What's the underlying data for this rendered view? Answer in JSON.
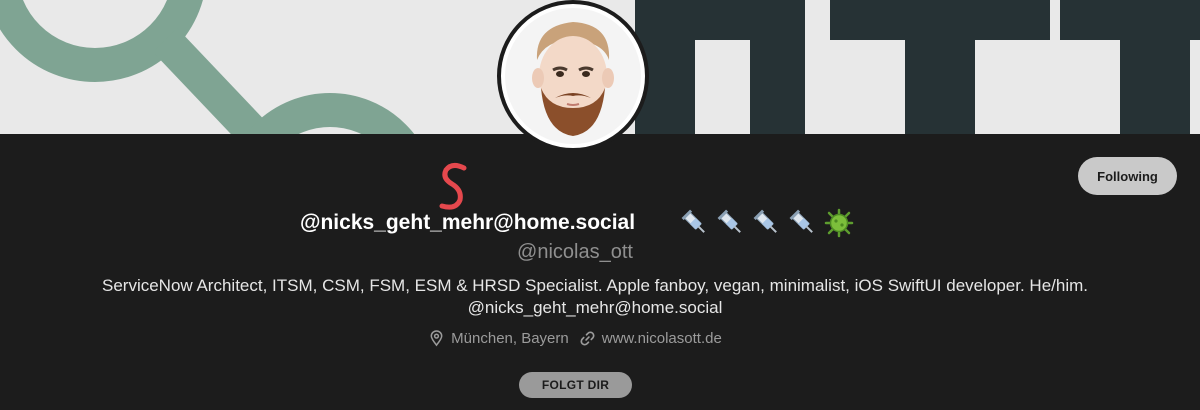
{
  "profile": {
    "display_name": "@nicks_geht_mehr@home.social",
    "annotation_mark": "S",
    "emojis": [
      "syringe-emoji",
      "syringe-emoji",
      "syringe-emoji",
      "syringe-emoji",
      "virus-emoji"
    ],
    "username": "@nicolas_ott",
    "bio_line1": "ServiceNow Architect, ITSM, CSM, FSM, ESM & HRSD Specialist. Apple fanboy, vegan, minimalist, iOS SwiftUI developer. He/him.",
    "bio_line2": "@nicks_geht_mehr@home.social",
    "location": "München, Bayern",
    "website": "www.nicolasott.de",
    "follows_you_badge": "FOLGT DIR"
  },
  "actions": {
    "following_label": "Following"
  },
  "colors": {
    "background": "#1c1c1c",
    "banner_bg": "#e9e9e9",
    "banner_green": "#7fa493",
    "banner_dark": "#263235",
    "annotation_red": "#e5484d"
  }
}
